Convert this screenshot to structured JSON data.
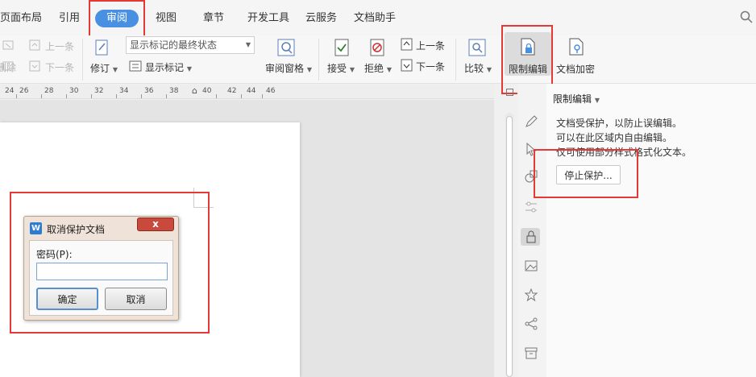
{
  "tabs": [
    {
      "label": "页面布局"
    },
    {
      "label": "引用"
    },
    {
      "label": "审阅"
    },
    {
      "label": "视图"
    },
    {
      "label": "章节"
    },
    {
      "label": "开发工具"
    },
    {
      "label": "云服务"
    },
    {
      "label": "文档助手"
    }
  ],
  "ribbon": {
    "prev_change": "上一条",
    "next_change": "下一条",
    "delete_label": "删除",
    "track_changes": "修订",
    "markup_state": "显示标记的最终状态",
    "show_markup": "显示标记",
    "review_pane": "审阅窗格",
    "accept": "接受",
    "reject": "拒绝",
    "prev_item": "上一条",
    "next_item": "下一条",
    "compare": "比较",
    "restrict_editing": "限制编辑",
    "encrypt": "文档加密"
  },
  "ruler": [
    "24",
    "26",
    "28",
    "30",
    "32",
    "34",
    "36",
    "38",
    "40",
    "42",
    "44",
    "46"
  ],
  "dialog": {
    "title": "取消保护文档",
    "close": "x",
    "password_label": "密码(P):",
    "password_value": "",
    "ok": "确定",
    "cancel": "取消"
  },
  "panel": {
    "title": "限制编辑",
    "line1": "文档受保护，以防止误编辑。",
    "line2": "可以在此区域内自由编辑。",
    "line3": "仅可使用部分样式格式化文本。",
    "stop_button": "停止保护..."
  },
  "colors": {
    "active_tab": "#4a90e2",
    "highlight_box": "#e53935"
  }
}
